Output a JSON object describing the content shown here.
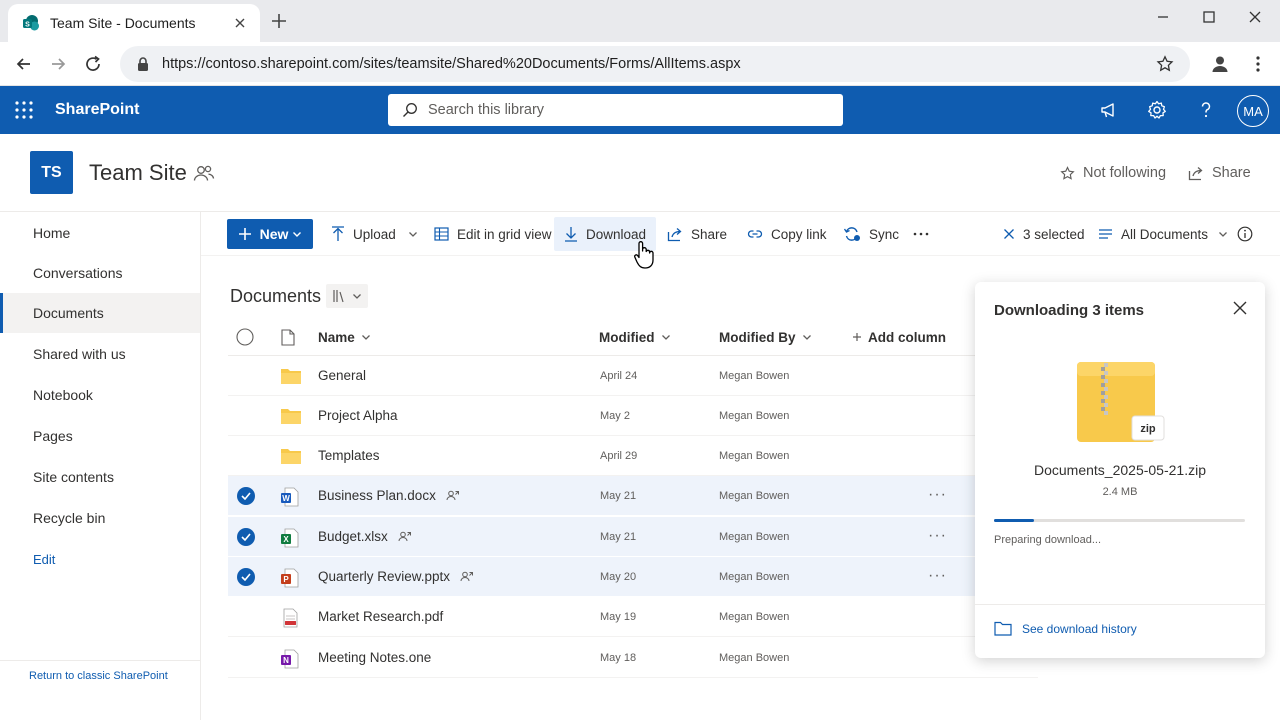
{
  "browser": {
    "tab_title": "Team Site - Documents",
    "url": "https://contoso.sharepoint.com/sites/teamsite/Shared%20Documents/Forms/AllItems.aspx"
  },
  "suite": {
    "brand": "SharePoint",
    "search_placeholder": "Search this library",
    "user_initials": "MA"
  },
  "site": {
    "logo": "TS",
    "title": "Team Site",
    "follow_label": "Not following",
    "share_label": "Share"
  },
  "nav": {
    "items": [
      "Home",
      "Conversations",
      "Documents",
      "Shared with us",
      "Notebook",
      "Pages",
      "Site contents",
      "Recycle bin"
    ],
    "active": "Documents",
    "edit": "Edit",
    "classic": "Return to classic SharePoint"
  },
  "commands": {
    "new": "New",
    "upload": "Upload",
    "grid": "Edit in grid view",
    "download": "Download",
    "share": "Share",
    "copy_link": "Copy link",
    "sync": "Sync",
    "selected": "3 selected",
    "view": "All Documents"
  },
  "library": {
    "title": "Documents",
    "columns": {
      "name": "Name",
      "modified": "Modified",
      "modified_by": "Modified By",
      "add": "Add column"
    },
    "rows": [
      {
        "name": "General",
        "modified": "April 24",
        "by": "Megan Bowen",
        "type": "folder",
        "selected": false
      },
      {
        "name": "Project Alpha",
        "modified": "May 2",
        "by": "Megan Bowen",
        "type": "folder",
        "selected": false
      },
      {
        "name": "Templates",
        "modified": "April 29",
        "by": "Megan Bowen",
        "type": "folder",
        "selected": false
      },
      {
        "name": "Business Plan.docx",
        "modified": "May 21",
        "by": "Megan Bowen",
        "type": "word",
        "selected": true
      },
      {
        "name": "Budget.xlsx",
        "modified": "May 21",
        "by": "Megan Bowen",
        "type": "excel",
        "selected": true
      },
      {
        "name": "Quarterly Review.pptx",
        "modified": "May 20",
        "by": "Megan Bowen",
        "type": "powerpoint",
        "selected": true
      },
      {
        "name": "Market Research.pdf",
        "modified": "May 19",
        "by": "Megan Bowen",
        "type": "pdf",
        "selected": false
      },
      {
        "name": "Meeting Notes.one",
        "modified": "May 18",
        "by": "Megan Bowen",
        "type": "onenote",
        "selected": false
      }
    ]
  },
  "download_panel": {
    "title": "Downloading 3 items",
    "zip_label": "zip",
    "file_name": "Documents_2025-05-21.zip",
    "file_size": "2.4 MB",
    "progress": 0.16,
    "status": "Preparing download...",
    "history_link": "See download history"
  },
  "colors": {
    "accent": "#0f5cb0",
    "folder": "#f8c94b",
    "selected_row": "#eef3fb"
  }
}
